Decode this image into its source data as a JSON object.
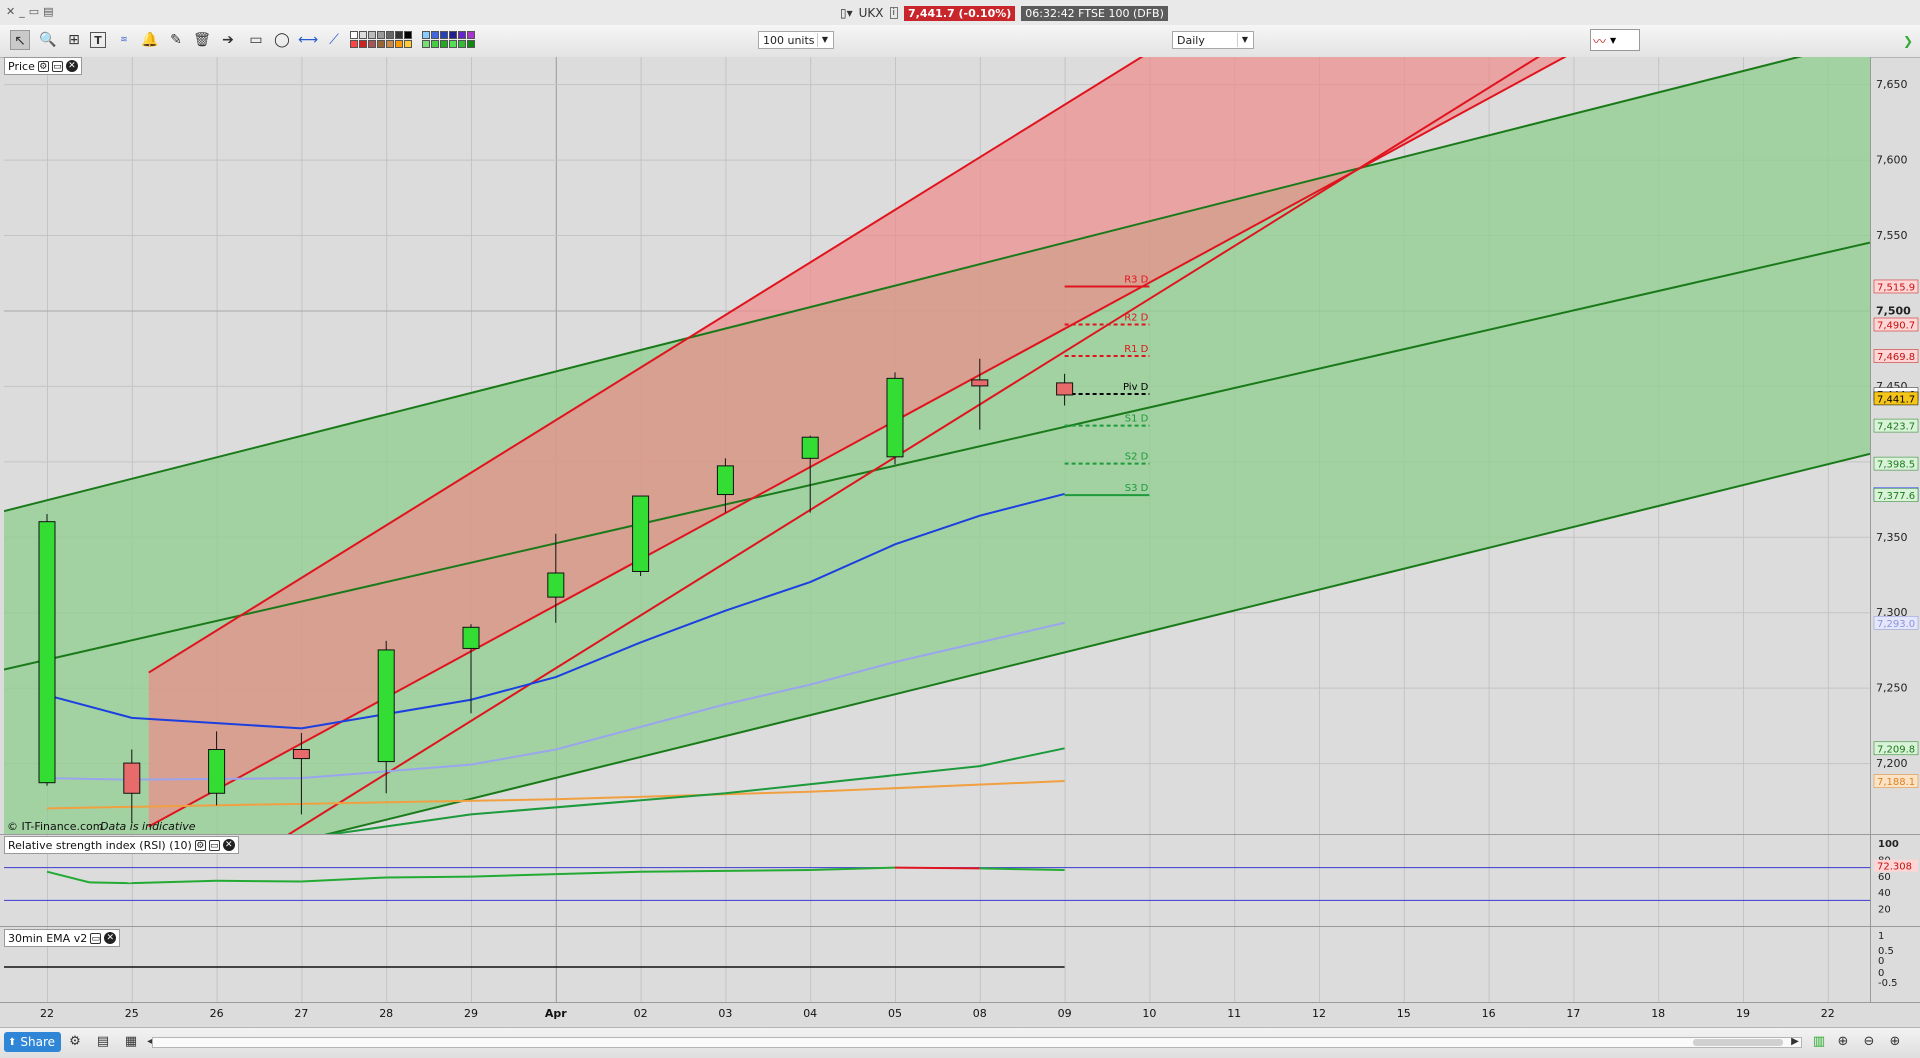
{
  "titlebar": {
    "symbol": "UKX",
    "price_badge": "7,441.7 (-0.10%)",
    "time_instrument": "06:32:42 FTSE 100 (DFB)"
  },
  "toolbar": {
    "units_select": "100 units",
    "interval_select": "Daily",
    "tool_icons": [
      "pointer-icon",
      "zoom-icon",
      "chart-type-icon",
      "text-icon",
      "fib-lines-icon",
      "alert-bell-icon",
      "ruler-icon",
      "trash-icon",
      "arrow-icon",
      "rectangle-icon",
      "ellipse-icon",
      "line-icon",
      "trendline-icon"
    ]
  },
  "price_panel": {
    "label": "Price",
    "watermark": "© IT-Finance.com",
    "disclaimer": "Data is indicative"
  },
  "rsi_panel": {
    "label": "Relative strength index (RSI) (10)"
  },
  "ema_panel": {
    "label": "30min EMA v2"
  },
  "bottombar": {
    "share_label": "Share"
  },
  "colors": {
    "bull": "#33dd33",
    "bear": "#e86b6b",
    "red_channel_fill": "#f08a8a",
    "green_channel_fill": "#8fcf8f",
    "ma_blue": "#1b3fe0",
    "ma_lightblue": "#9aa5ee",
    "ma_orange": "#f0a040",
    "ma_green": "#1d9a3b",
    "current_price": "#f5c518"
  },
  "chart_data": {
    "type": "candlestick",
    "x_tick_labels": [
      "22",
      "25",
      "26",
      "27",
      "28",
      "29",
      "Apr",
      "02",
      "03",
      "04",
      "05",
      "08",
      "09",
      "10",
      "11",
      "12",
      "15",
      "16",
      "17",
      "18",
      "19",
      "22"
    ],
    "y_ticks": [
      7200,
      7250,
      7300,
      7350,
      7400,
      7450,
      7500,
      7550,
      7600,
      7650
    ],
    "y_tick_labels": [
      "7,200",
      "7,250",
      "7,300",
      "7,350",
      "7,400",
      "7,450",
      "7,500",
      "7,550",
      "7,600",
      "7,650"
    ],
    "ylim": [
      7153,
      7668
    ],
    "candles": [
      {
        "i": 0,
        "open": 7187,
        "high": 7365,
        "low": 7185,
        "close": 7360
      },
      {
        "i": 1,
        "open": 7200,
        "high": 7209,
        "low": 7160,
        "close": 7180
      },
      {
        "i": 2,
        "open": 7180,
        "high": 7221,
        "low": 7172,
        "close": 7209
      },
      {
        "i": 3,
        "open": 7209,
        "high": 7220,
        "low": 7166,
        "close": 7203
      },
      {
        "i": 4,
        "open": 7201,
        "high": 7281,
        "low": 7180,
        "close": 7275
      },
      {
        "i": 5,
        "open": 7276,
        "high": 7292,
        "low": 7233,
        "close": 7290
      },
      {
        "i": 6,
        "open": 7310,
        "high": 7352,
        "low": 7293,
        "close": 7326
      },
      {
        "i": 7,
        "open": 7327,
        "high": 7360,
        "low": 7324,
        "close": 7377
      },
      {
        "i": 8,
        "open": 7378,
        "high": 7402,
        "low": 7366,
        "close": 7397
      },
      {
        "i": 9,
        "open": 7402,
        "high": 7417,
        "low": 7366,
        "close": 7416
      },
      {
        "i": 10,
        "open": 7403,
        "high": 7459,
        "low": 7398,
        "close": 7455
      },
      {
        "i": 11,
        "open": 7454,
        "high": 7468,
        "low": 7421,
        "close": 7450
      },
      {
        "i": 12,
        "open": 7452,
        "high": 7458,
        "low": 7437,
        "close": 7444
      }
    ],
    "pivots": [
      {
        "label": "R3 D",
        "value": 7515.9,
        "color": "#e0141e",
        "style": "solid"
      },
      {
        "label": "R2 D",
        "value": 7490.7,
        "color": "#e0141e",
        "style": "dashed"
      },
      {
        "label": "R1 D",
        "value": 7469.8,
        "color": "#e0141e",
        "style": "dashed"
      },
      {
        "label": "Piv D",
        "value": 7444.6,
        "color": "#000000",
        "style": "dashed"
      },
      {
        "label": "S1 D",
        "value": 7423.7,
        "color": "#1d9a3b",
        "style": "dashed"
      },
      {
        "label": "S2 D",
        "value": 7398.5,
        "color": "#1d9a3b",
        "style": "dashed"
      },
      {
        "label": "S3 D",
        "value": 7377.6,
        "color": "#1d9a3b",
        "style": "solid"
      }
    ],
    "right_axis_labels": [
      {
        "text": "7,515.9",
        "value": 7515.9,
        "bg": "#ffd6d6",
        "fg": "#c41010"
      },
      {
        "text": "7,490.7",
        "value": 7490.7,
        "bg": "#ffd6d6",
        "fg": "#c41010"
      },
      {
        "text": "7,469.8",
        "value": 7469.8,
        "bg": "#ffd6d6",
        "fg": "#c41010"
      },
      {
        "text": "7,444.6",
        "value": 7444.6,
        "bg": "#ffffff",
        "fg": "#222222"
      },
      {
        "text": "7,441.7",
        "value": 7441.7,
        "bg": "#f5c518",
        "fg": "#000000"
      },
      {
        "text": "7,423.7",
        "value": 7423.7,
        "bg": "#d9f3d9",
        "fg": "#1b7a1b"
      },
      {
        "text": "7,398.5",
        "value": 7398.5,
        "bg": "#d9f3d9",
        "fg": "#1b7a1b"
      },
      {
        "text": "7,378.4",
        "value": 7378.4,
        "bg": "#dfe3ff",
        "fg": "#1b3fe0"
      },
      {
        "text": "7,377.6",
        "value": 7377.6,
        "bg": "#d9f3d9",
        "fg": "#1b7a1b"
      },
      {
        "text": "7,293.0",
        "value": 7293.0,
        "bg": "#e4e6fb",
        "fg": "#8c93d8"
      },
      {
        "text": "7,209.8",
        "value": 7209.8,
        "bg": "#d9f3d9",
        "fg": "#1b7a1b"
      },
      {
        "text": "7,188.1",
        "value": 7188.1,
        "bg": "#fde3c6",
        "fg": "#d98326"
      }
    ],
    "moving_averages": [
      {
        "color": "#1b3fe0",
        "points": [
          [
            0,
            7245
          ],
          [
            1,
            7230
          ],
          [
            3,
            7223
          ],
          [
            5,
            7242
          ],
          [
            6,
            7257
          ],
          [
            7,
            7280
          ],
          [
            8,
            7301
          ],
          [
            9,
            7320
          ],
          [
            10,
            7345
          ],
          [
            11,
            7364
          ],
          [
            12,
            7378.4
          ]
        ]
      },
      {
        "color": "#9aa5ee",
        "points": [
          [
            0,
            7190
          ],
          [
            1,
            7189
          ],
          [
            3,
            7190
          ],
          [
            5,
            7199
          ],
          [
            6,
            7209
          ],
          [
            7,
            7224
          ],
          [
            8,
            7239
          ],
          [
            9,
            7252
          ],
          [
            10,
            7267
          ],
          [
            11,
            7280
          ],
          [
            12,
            7293.0
          ]
        ]
      },
      {
        "color": "#f0a040",
        "points": [
          [
            0,
            7170
          ],
          [
            1,
            7171
          ],
          [
            3,
            7173
          ],
          [
            6,
            7176
          ],
          [
            9,
            7181
          ],
          [
            12,
            7188.1
          ]
        ]
      },
      {
        "color": "#1d9a3b",
        "points": [
          [
            3,
            7150
          ],
          [
            5,
            7166
          ],
          [
            8,
            7180
          ],
          [
            11,
            7198
          ],
          [
            12,
            7209.8
          ]
        ]
      }
    ],
    "rsi": {
      "value_label": "72.308",
      "axis_labels": [
        "100",
        "80",
        "60",
        "40",
        "20"
      ],
      "levels": [
        70,
        30
      ],
      "points": [
        [
          0,
          65
        ],
        [
          0.5,
          52
        ],
        [
          1,
          51
        ],
        [
          2,
          54
        ],
        [
          3,
          53
        ],
        [
          4,
          58
        ],
        [
          5,
          59
        ],
        [
          6,
          62
        ],
        [
          7,
          65
        ],
        [
          8,
          66
        ],
        [
          9,
          67
        ],
        [
          10,
          70
        ],
        [
          11,
          69
        ],
        [
          12,
          67
        ]
      ]
    },
    "ema": {
      "axis_labels": [
        "1",
        "0.5",
        "0",
        "0",
        "-0.5"
      ]
    }
  }
}
